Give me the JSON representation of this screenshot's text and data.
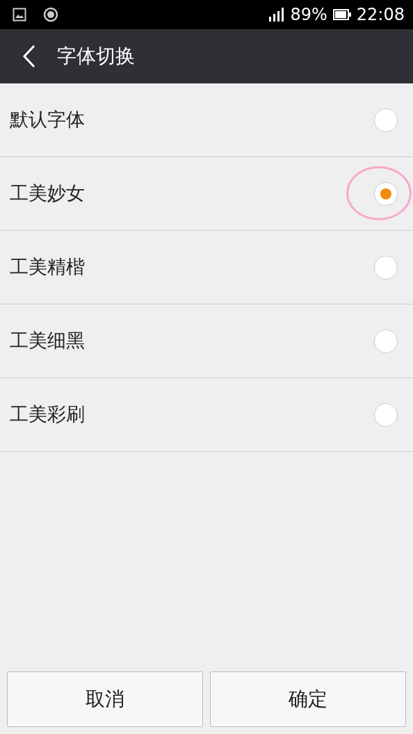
{
  "status_bar": {
    "battery_percent": "89%",
    "time": "22:08"
  },
  "header": {
    "title": "字体切换"
  },
  "fonts": [
    {
      "label": "默认字体",
      "selected": false
    },
    {
      "label": "工美妙女",
      "selected": true
    },
    {
      "label": "工美精楷",
      "selected": false
    },
    {
      "label": "工美细黑",
      "selected": false
    },
    {
      "label": "工美彩刷",
      "selected": false
    }
  ],
  "annotation": {
    "kind": "ellipse",
    "color": "#f8a8cc"
  },
  "buttons": [
    {
      "label": "取消"
    },
    {
      "label": "确定"
    }
  ]
}
